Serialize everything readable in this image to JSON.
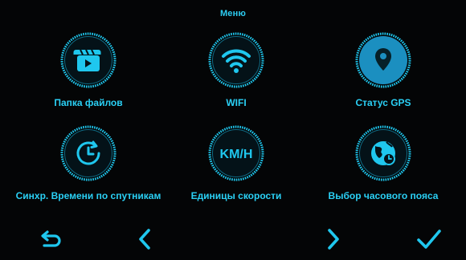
{
  "header": {
    "title": "Меню"
  },
  "menu": [
    {
      "label": "Папка файлов",
      "icon": "video-folder-icon",
      "selected": false
    },
    {
      "label": "WIFI",
      "icon": "wifi-icon",
      "selected": false
    },
    {
      "label": "Статус GPS",
      "icon": "location-pin-icon",
      "selected": true
    },
    {
      "label": "Синхр. Времени по спутникам",
      "icon": "time-sync-icon",
      "selected": false
    },
    {
      "label": "Единицы скорости",
      "icon_text": "KM/H",
      "icon": "speed-unit-icon",
      "selected": false
    },
    {
      "label": "Выбор часового пояса",
      "icon": "timezone-globe-icon",
      "selected": false
    }
  ],
  "nav": [
    {
      "icon": "back-icon"
    },
    {
      "icon": "chevron-left-icon"
    },
    {
      "icon": "chevron-right-icon"
    },
    {
      "icon": "checkmark-icon"
    }
  ],
  "colors": {
    "accent": "#1fc7ee",
    "selected_fill": "#1b8fc0",
    "background": "#040506"
  }
}
